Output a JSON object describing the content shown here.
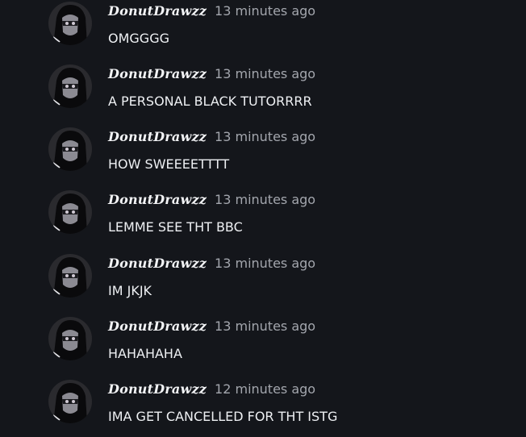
{
  "messages": [
    {
      "author": "DonutDrawzz",
      "time": "13 minutes ago",
      "text": "OMGGGG"
    },
    {
      "author": "DonutDrawzz",
      "time": "13 minutes ago",
      "text": "A PERSONAL BLACK TUTORRRR"
    },
    {
      "author": "DonutDrawzz",
      "time": "13 minutes ago",
      "text": "HOW SWEEEETTTT"
    },
    {
      "author": "DonutDrawzz",
      "time": "13 minutes ago",
      "text": "LEMME SEE THT BBC"
    },
    {
      "author": "DonutDrawzz",
      "time": "13 minutes ago",
      "text": "IM JKJK"
    },
    {
      "author": "DonutDrawzz",
      "time": "13 minutes ago",
      "text": "HAHAHAHA"
    },
    {
      "author": "DonutDrawzz",
      "time": "12 minutes ago",
      "text": "IMA GET CANCELLED FOR THT ISTG"
    }
  ],
  "colors": {
    "background": "#14161b",
    "username": "#f2f3f5",
    "timestamp": "#a3a6ad",
    "message_text": "#eef0f3"
  },
  "icons": {
    "avatar": "user-avatar-icon"
  }
}
